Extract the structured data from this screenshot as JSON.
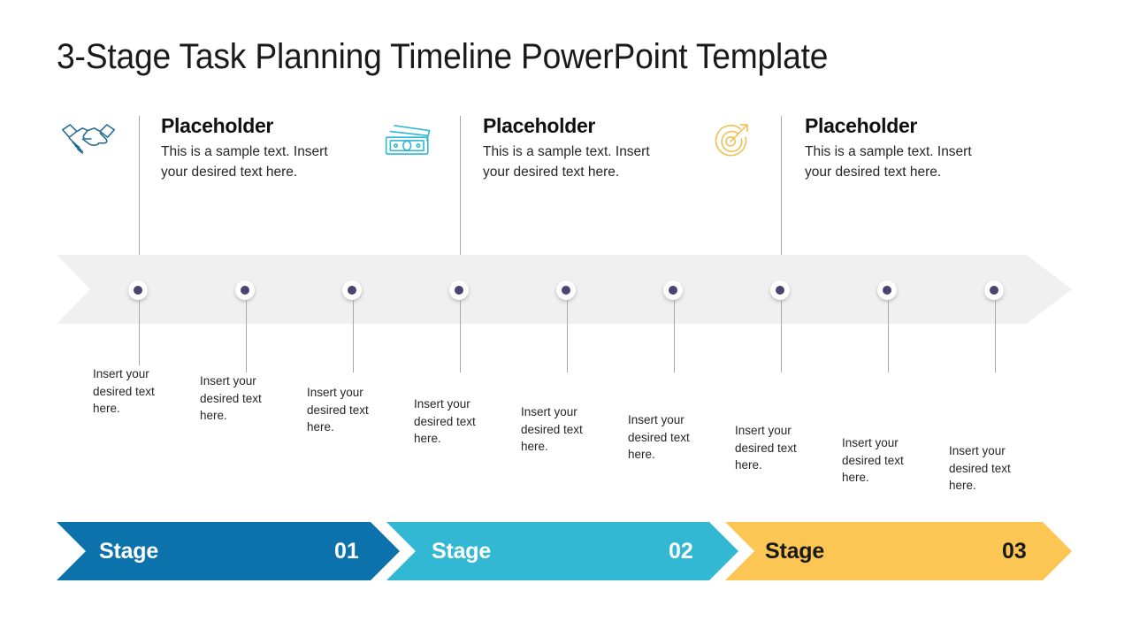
{
  "slide": {
    "title": "3-Stage Task Planning Timeline PowerPoint Template",
    "background_color": "#FFFFFF"
  },
  "colors": {
    "stage1": "#0B72AC",
    "stage2": "#33B8D3",
    "stage3": "#FCC654",
    "band_gray": "#F0F0F0",
    "dot_core": "#4A4470",
    "dot_ring": "#FFFFFF",
    "connector_line": "#A8A8A8",
    "title_text": "#1A1A1A",
    "body_text": "#262626"
  },
  "top_blocks": [
    {
      "icon": "handshake-icon",
      "icon_color": "#21698F",
      "heading": "Placeholder",
      "body": "This is a sample text. Insert your desired text here."
    },
    {
      "icon": "money-banknotes-icon",
      "icon_color": "#2EB8D4",
      "heading": "Placeholder",
      "body": "This is a sample text. Insert your desired text here."
    },
    {
      "icon": "target-arrow-icon",
      "icon_color": "#EFC152",
      "heading": "Placeholder",
      "body": "This is a sample text. Insert your desired text here."
    }
  ],
  "timeline": {
    "dot_count": 9,
    "captions": [
      "Insert your desired text here.",
      "Insert your desired text here.",
      "Insert your desired text here.",
      "Insert your desired text here.",
      "Insert your desired text here.",
      "Insert your desired text here.",
      "Insert your desired text here.",
      "Insert your desired text here.",
      "Insert your desired text here."
    ]
  },
  "stages": [
    {
      "label": "Stage",
      "number": "01",
      "fill": "#0B72AC",
      "text_color": "#FFFFFF"
    },
    {
      "label": "Stage",
      "number": "02",
      "fill": "#33B8D3",
      "text_color": "#FFFFFF"
    },
    {
      "label": "Stage",
      "number": "03",
      "fill": "#FCC654",
      "text_color": "#1A1A1A"
    }
  ]
}
